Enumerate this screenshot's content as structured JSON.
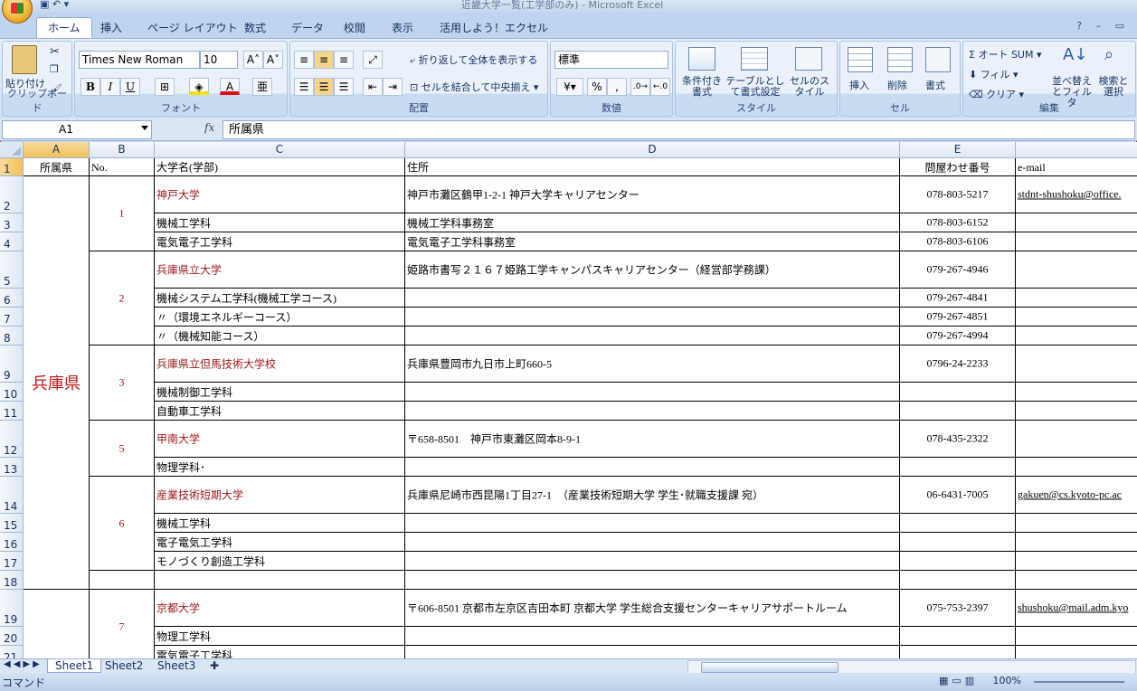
{
  "window": {
    "title": "近畿大学一覧(工学部のみ) - Microsoft Excel",
    "qat": "▣ ↶ ▾"
  },
  "ribbon": {
    "tabs": [
      "ホーム",
      "挿入",
      "ページ レイアウト",
      "数式",
      "データ",
      "校閲",
      "表示",
      "活用しよう！エクセル"
    ],
    "clipboard": {
      "paste": "貼り付け",
      "label": "クリップボード"
    },
    "font": {
      "name": "Times New Roman",
      "size": "10",
      "bold": "B",
      "italic": "I",
      "underline": "U",
      "label": "フォント"
    },
    "alignment": {
      "wrap": "折り返して全体を表示する",
      "merge": "セルを結合して中央揃え",
      "label": "配置"
    },
    "number": {
      "format": "標準",
      "percent": "%",
      "comma": ",",
      "label": "数値"
    },
    "styles": {
      "cond": "条件付き書式",
      "table": "テーブルとして書式設定",
      "cell": "セルのスタイル",
      "label": "スタイル"
    },
    "cells": {
      "insert": "挿入",
      "delete": "削除",
      "format": "書式",
      "label": "セル"
    },
    "editing": {
      "autosum": "オート SUM",
      "fill": "フィル",
      "clear": "クリア",
      "sort": "並べ替えとフィルタ",
      "find": "検索と選択",
      "label": "編集"
    }
  },
  "formula_bar": {
    "namebox": "A1",
    "fx": "fx",
    "content": "所属県"
  },
  "columns": [
    "A",
    "B",
    "C",
    "D",
    "E",
    ""
  ],
  "rows": [
    "1",
    "2",
    "3",
    "4",
    "5",
    "6",
    "7",
    "8",
    "9",
    "10",
    "11",
    "12",
    "13",
    "14",
    "15",
    "16",
    "17",
    "18",
    "19",
    "20",
    "21"
  ],
  "cells": {
    "a1": "所属県",
    "b1": "No.",
    "c1": "大学名(学部)",
    "d1": "住所",
    "e1": "問屋わせ番号",
    "f1": "e-mail",
    "pref_hyogo": "兵庫県",
    "no1": "1",
    "no2": "2",
    "no3": "3",
    "no5": "5",
    "no6": "6",
    "no7": "7",
    "c2": "神戸大学",
    "d2": "神戸市灘区鶴甲1-2-1 神戸大学キャリアセンター",
    "e2": "078-803-5217",
    "f2": "stdnt-shushoku@office.",
    "c3": "機械工学科",
    "d3": "機械工学科事務室",
    "e3": "078-803-6152",
    "c4": "電気電子工学科",
    "d4": "電気電子工学科事務室",
    "e4": "078-803-6106",
    "c5": "兵庫県立大学",
    "d5": "姫路市書写２１６７姫路工学キャンパスキャリアセンター（経営部学務課）",
    "e5": "079-267-4946",
    "c6": "機械システム工学科(機械工学コース)",
    "e6": "079-267-4841",
    "c7": "〃（環境エネルギーコース）",
    "e7": "079-267-4851",
    "c8": "〃（機械知能コース）",
    "e8": "079-267-4994",
    "c9": "兵庫県立但馬技術大学校",
    "d9": "兵庫県豊岡市九日市上町660-5",
    "e9": "0796-24-2233",
    "c10": "機械制御工学科",
    "c11": "自動車工学科",
    "c12": "甲南大学",
    "d12": "〒658-8501　神戸市東灘区岡本8-9-1",
    "e12": "078-435-2322",
    "c13": "物理学科･",
    "c14": "産業技術短期大学",
    "d14": "兵庫県尼崎市西昆陽1丁目27-1　（産業技術短期大学  学生･就職支援課  宛）",
    "e14": "06-6431-7005",
    "f14": "gakuen@cs.kyoto-pc.ac",
    "c15": "機械工学科",
    "c16": "電子電気工学科",
    "c17": "モノづくり創造工学科",
    "c19": "京都大学",
    "d19": "〒606-8501 京都市左京区吉田本町 京都大学 学生総合支援センターキャリアサポートルーム",
    "e19": "075-753-2397",
    "f19": "shushoku@mail.adm.kyo",
    "c20": "物理工学科",
    "c21": "電気電子工学科"
  },
  "sheets": [
    "Sheet1",
    "Sheet2",
    "Sheet3"
  ],
  "status": {
    "mode": "コマンド",
    "zoom": "100%"
  }
}
